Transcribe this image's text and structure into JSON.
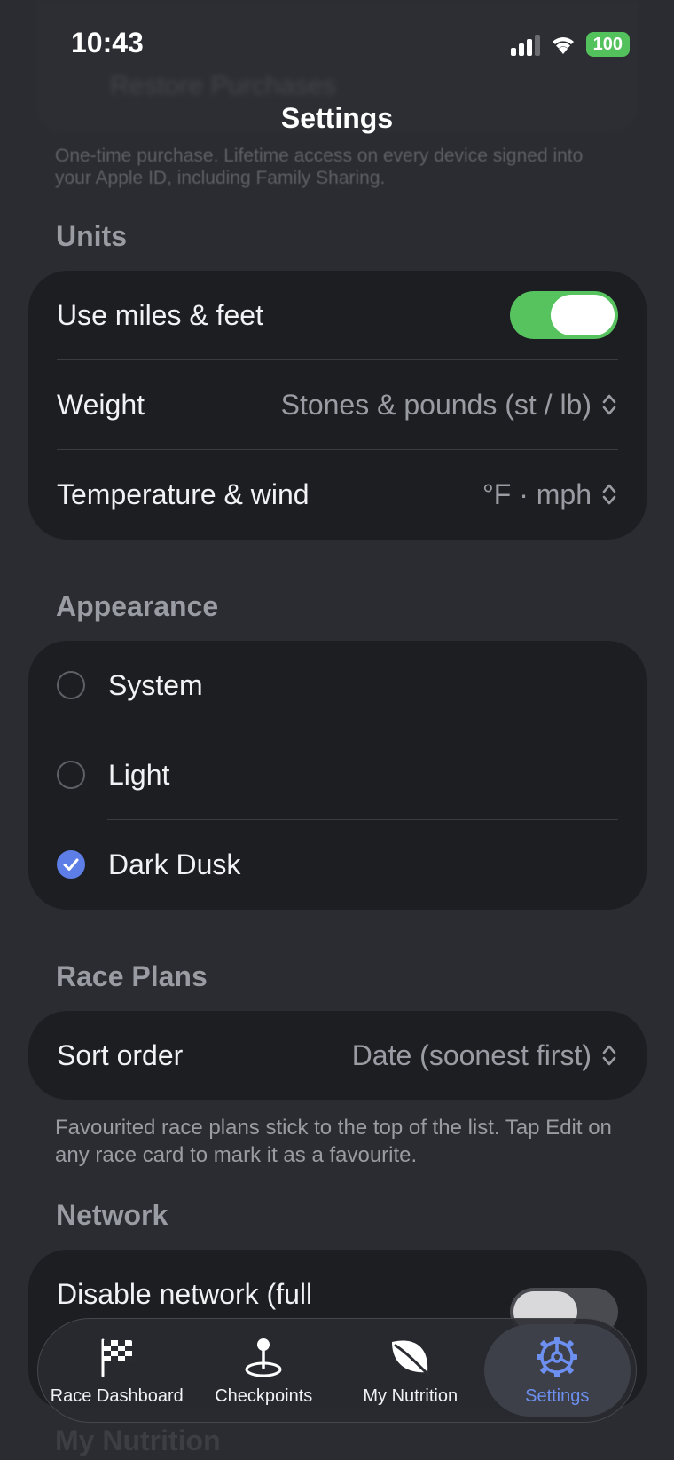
{
  "status_bar": {
    "time": "10:43",
    "battery": "100"
  },
  "background": {
    "restore_label": "Restore Purchases"
  },
  "nav": {
    "title": "Settings"
  },
  "purchase_note": "One-time purchase. Lifetime access on every device signed into your Apple ID, including Family Sharing.",
  "units": {
    "header": "Units",
    "miles_label": "Use miles & feet",
    "miles_on": true,
    "weight_label": "Weight",
    "weight_value": "Stones & pounds (st / lb)",
    "temp_label": "Temperature & wind",
    "temp_value": "°F · mph"
  },
  "appearance": {
    "header": "Appearance",
    "options": [
      {
        "label": "System",
        "selected": false
      },
      {
        "label": "Light",
        "selected": false
      },
      {
        "label": "Dark Dusk",
        "selected": true
      }
    ]
  },
  "race_plans": {
    "header": "Race Plans",
    "sort_label": "Sort order",
    "sort_value": "Date (soonest first)",
    "footnote": "Favourited race plans stick to the top of the list. Tap Edit on any race card to mark it as a favourite."
  },
  "network": {
    "header": "Network",
    "disable_label": "Disable network (full",
    "disable_on": false
  },
  "next_section": {
    "header": "My Nutrition"
  },
  "tabs": [
    {
      "label": "Race Dashboard",
      "icon": "checkered-flag-icon"
    },
    {
      "label": "Checkpoints",
      "icon": "map-pin-icon"
    },
    {
      "label": "My Nutrition",
      "icon": "leaf-icon"
    },
    {
      "label": "Settings",
      "icon": "gear-icon",
      "active": true
    }
  ],
  "colors": {
    "accent": "#6d8ff0",
    "toggle_on": "#56c35f",
    "background": "#2a2c31",
    "card": "#1d1e22"
  }
}
